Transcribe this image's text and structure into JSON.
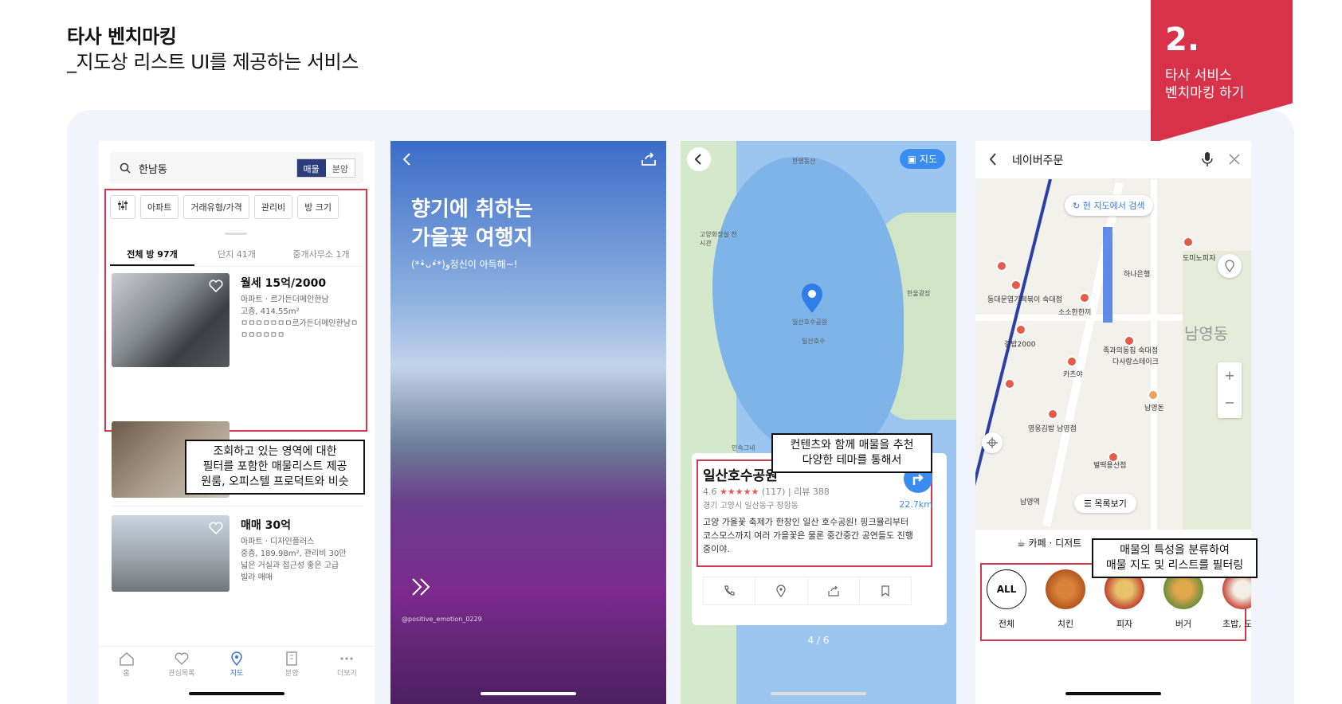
{
  "heading": {
    "title": "타사 벤치마킹",
    "subtitle": "_지도상 리스트 UI를 제공하는 서비스"
  },
  "ribbon": {
    "number": "2.",
    "label_line1": "타사 서비스",
    "label_line2": "벤치마킹 하기"
  },
  "phone1": {
    "search_value": "한남동",
    "toggle": [
      "매물",
      "분양"
    ],
    "filters": [
      "아파트",
      "거래유형/가격",
      "관리비",
      "방 크기"
    ],
    "tabs": [
      "전체 방 97개",
      "단지 41개",
      "중개사무소 1개"
    ],
    "listings": [
      {
        "price": "월세 15억/2000",
        "meta1": "아파트 · 르가든더메인한남",
        "meta2": "고층, 414.55m²",
        "meta3": "ㅁㅁㅁㅁㅁㅁㅁ르가든더메인한남ㅁ",
        "meta4": "ㅁㅁㅁㅁㅁㅁ"
      },
      {
        "price": "매매 30억",
        "meta1": "아파트 · 디자인플러스",
        "meta2": "중층, 189.98m², 관리비 30만",
        "meta3": "넓은 거실과 접근성 좋은 고급",
        "meta4": "빌라 매매"
      }
    ],
    "nav": [
      "홈",
      "관심목록",
      "지도",
      "분양",
      "더보기"
    ],
    "annotation": "조회하고 있는 영역에 대한\n필터를 포함한 매물리스트 제공\n원룸, 오피스텔 프로덕트와 비슷"
  },
  "phone2": {
    "title_line1": "향기에 취하는",
    "title_line2": "가을꽃 여행지",
    "subtitle": "(*•̀ᴗ•́*)و정신이 아득해~!",
    "credit": "@positive_emotion_0229"
  },
  "phone3": {
    "map_button": "지도",
    "map_labels": [
      "한명동산",
      "고양화장실 전시관",
      "일산호수공원",
      "일산호수",
      "한울광장",
      "민속그네"
    ],
    "place_name": "일산호수공원",
    "rating": "4.6",
    "stars": "★★★★★",
    "review_count": "(117)",
    "review_label": "리뷰 388",
    "address": "경기 고양시 일산동구 장항동",
    "distance": "22.7km",
    "description": "고양 가을꽃 축제가 한창인 일산 호수공원! 핑크뮬리부터 코스모스까지 여러 가을꽃은 물론 중간중간 공연들도 진행 중이야.",
    "pager": "4 / 6",
    "annotation": "컨텐츠와 함께 매물을 추천\n다양한 테마를 통해서"
  },
  "phone4": {
    "search_value": "네이버주문",
    "search_here": "현 지도에서 검색",
    "map_labels": [
      "동대문엽기떡볶이 숙대점",
      "소소한한끼",
      "김밥2000",
      "족과의동침 숙대점",
      "다사랑스테이크",
      "카츠야",
      "남영돈",
      "영웅김밥 남영점",
      "벌떡용산점",
      "하나은행",
      "도미노피자",
      "남영동",
      "남영역"
    ],
    "list_button": "목록보기",
    "cafe_chip": "카페 · 디저트",
    "categories": [
      "전체",
      "치킨",
      "피자",
      "버거",
      "초밥, 도시락"
    ],
    "all_label": "ALL",
    "annotation": "매물의 특성을 분류하여\n매물 지도 및 리스트를 필터링"
  },
  "colors": {
    "accent_red": "#d8324a",
    "link_blue": "#3a8df0"
  }
}
